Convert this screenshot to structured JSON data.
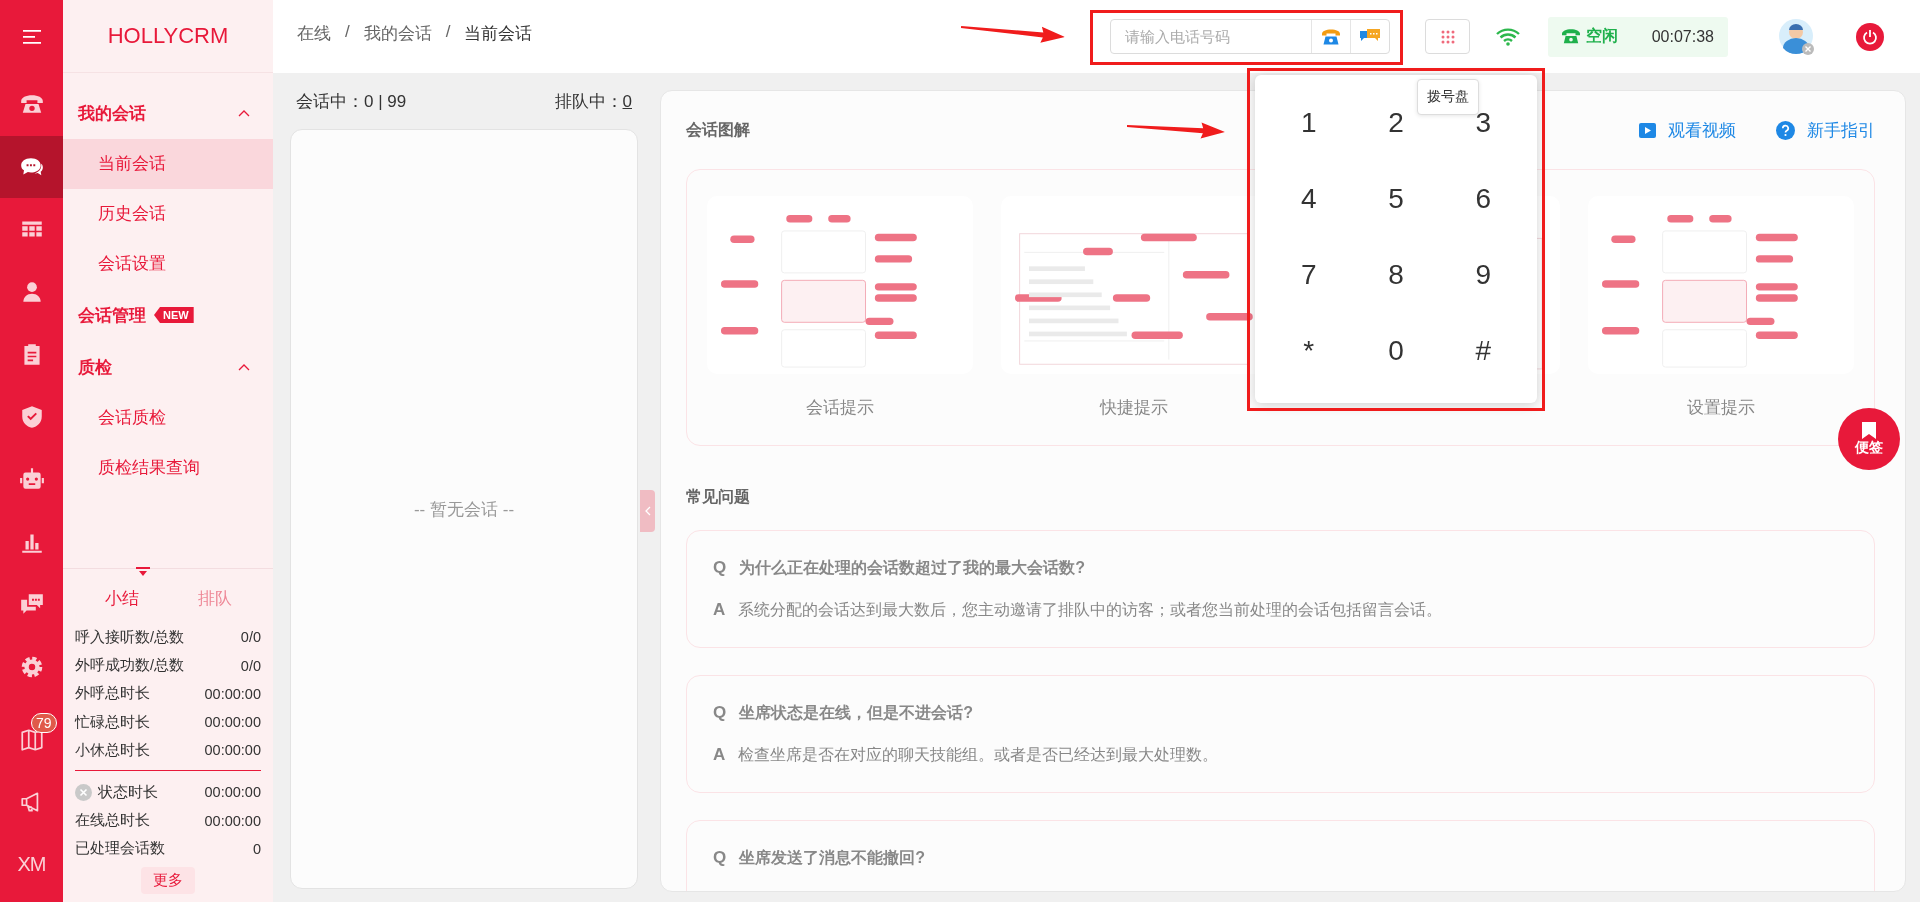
{
  "rail": {
    "items": [
      {
        "kind": "main",
        "selected": false
      },
      {
        "kind": "main",
        "selected": true
      },
      {
        "kind": "main",
        "selected": false
      },
      {
        "kind": "main",
        "selected": false
      },
      {
        "kind": "main",
        "selected": false
      },
      {
        "kind": "main",
        "selected": false
      },
      {
        "kind": "main",
        "selected": false
      },
      {
        "kind": "main",
        "selected": false
      },
      {
        "kind": "main",
        "selected": false
      },
      {
        "kind": "main",
        "selected": false
      },
      {
        "kind": "footer",
        "selected": false,
        "badge": "79"
      },
      {
        "kind": "footer",
        "selected": false
      },
      {
        "kind": "footer",
        "selected": false,
        "label": "XM"
      }
    ]
  },
  "sidebar": {
    "brand": "HOLLYCRM",
    "menu": [
      {
        "kind": "group",
        "label": "我的会话",
        "expanded": true,
        "children": [
          {
            "label": "当前会话",
            "selected": true
          },
          {
            "label": "历史会话",
            "selected": false
          },
          {
            "label": "会话设置",
            "selected": false
          }
        ]
      },
      {
        "kind": "link",
        "label": "会话管理",
        "badge": "NEW"
      },
      {
        "kind": "group",
        "label": "质检",
        "expanded": true,
        "children": [
          {
            "label": "会话质检",
            "selected": false
          },
          {
            "label": "质检结果查询",
            "selected": false
          }
        ]
      }
    ],
    "summary": {
      "tabs": [
        {
          "label": "小结",
          "selected": true
        },
        {
          "label": "排队",
          "selected": false
        }
      ],
      "stats": [
        {
          "label": "呼入接听数/总数",
          "value": "0/0"
        },
        {
          "label": "外呼成功数/总数",
          "value": "0/0"
        },
        {
          "label": "外呼总时长",
          "value": "00:00:00"
        },
        {
          "label": "忙碌总时长",
          "value": "00:00:00"
        },
        {
          "label": "小休总时长",
          "value": "00:00:00"
        }
      ],
      "more_stats": [
        {
          "kind": "status",
          "label": "状态时长",
          "value": "00:00:00"
        },
        {
          "kind": "plain",
          "label": "在线总时长",
          "value": "00:00:00"
        },
        {
          "kind": "plain",
          "label": "已处理会话数",
          "value": "0"
        }
      ],
      "more_button": "更多"
    }
  },
  "topbar": {
    "breadcrumb": [
      "在线",
      "我的会话",
      "当前会话"
    ],
    "breadcrumb_separator": "/",
    "phone_field": {
      "placeholder": "请输入电话号码"
    },
    "status": {
      "label": "空闲",
      "timer": "00:07:38"
    },
    "tooltip": "拨号盘"
  },
  "dialpad": {
    "keys": [
      "1",
      "2",
      "3",
      "4",
      "5",
      "6",
      "7",
      "8",
      "9",
      "*",
      "0",
      "#"
    ]
  },
  "sessions": {
    "active_label": "会话中：",
    "active_value": "0 | 99",
    "queue_label": "排队中：",
    "queue_value": "0",
    "empty": "-- 暂无会话 --"
  },
  "guide": {
    "title": "会话图解",
    "links": [
      "观看视频",
      "新手指引"
    ],
    "thumbnails": [
      {
        "kind": "captioned",
        "caption": "会话提示"
      },
      {
        "kind": "captioned",
        "caption": "快捷提示"
      },
      {
        "kind": "covered"
      },
      {
        "kind": "captioned",
        "caption": "设置提示"
      }
    ]
  },
  "faq": {
    "title": "常见问题",
    "items": [
      {
        "q_mark": "Q",
        "question": "为什么正在处理的会话数超过了我的最大会话数?",
        "a_mark": "A",
        "answer": "系统分配的会话达到最大数后，您主动邀请了排队中的访客；或者您当前处理的会话包括留言会话。"
      },
      {
        "q_mark": "Q",
        "question": "坐席状态是在线，但是不进会话?",
        "a_mark": "A",
        "answer": "检查坐席是否在对应的聊天技能组。或者是否已经达到最大处理数。"
      },
      {
        "q_mark": "Q",
        "question": "坐席发送了消息不能撤回?"
      }
    ]
  },
  "float_button": "便签"
}
